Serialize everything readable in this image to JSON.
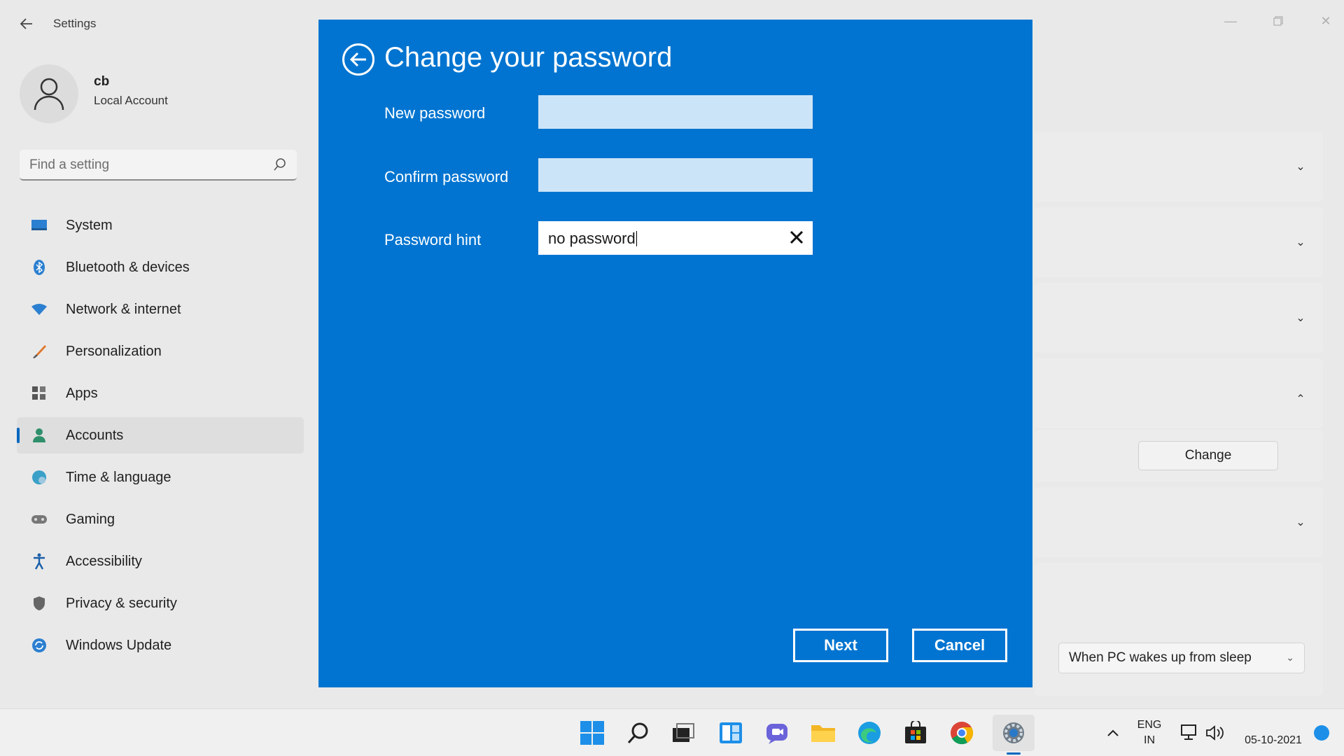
{
  "window": {
    "title": "Settings"
  },
  "profile": {
    "name": "cb",
    "account_type": "Local Account"
  },
  "search": {
    "placeholder": "Find a setting"
  },
  "sidebar": {
    "items": [
      {
        "label": "System",
        "icon": "monitor-icon"
      },
      {
        "label": "Bluetooth & devices",
        "icon": "bluetooth-icon"
      },
      {
        "label": "Network & internet",
        "icon": "wifi-icon"
      },
      {
        "label": "Personalization",
        "icon": "brush-icon"
      },
      {
        "label": "Apps",
        "icon": "apps-icon"
      },
      {
        "label": "Accounts",
        "icon": "person-icon",
        "active": true
      },
      {
        "label": "Time & language",
        "icon": "globe-clock-icon"
      },
      {
        "label": "Gaming",
        "icon": "gamepad-icon"
      },
      {
        "label": "Accessibility",
        "icon": "accessibility-icon"
      },
      {
        "label": "Privacy & security",
        "icon": "shield-icon"
      },
      {
        "label": "Windows Update",
        "icon": "update-icon"
      }
    ]
  },
  "content": {
    "change_button": "Change",
    "dropdown_value": "When PC wakes up from sleep"
  },
  "dialog": {
    "title": "Change your password",
    "new_password_label": "New password",
    "confirm_password_label": "Confirm password",
    "hint_label": "Password hint",
    "hint_value": "no password",
    "next_button": "Next",
    "cancel_button": "Cancel"
  },
  "taskbar": {
    "language": "ENG",
    "region": "IN",
    "date": "05-10-2021"
  },
  "colors": {
    "dialog_bg": "#0074d0",
    "accent": "#0067c0"
  }
}
